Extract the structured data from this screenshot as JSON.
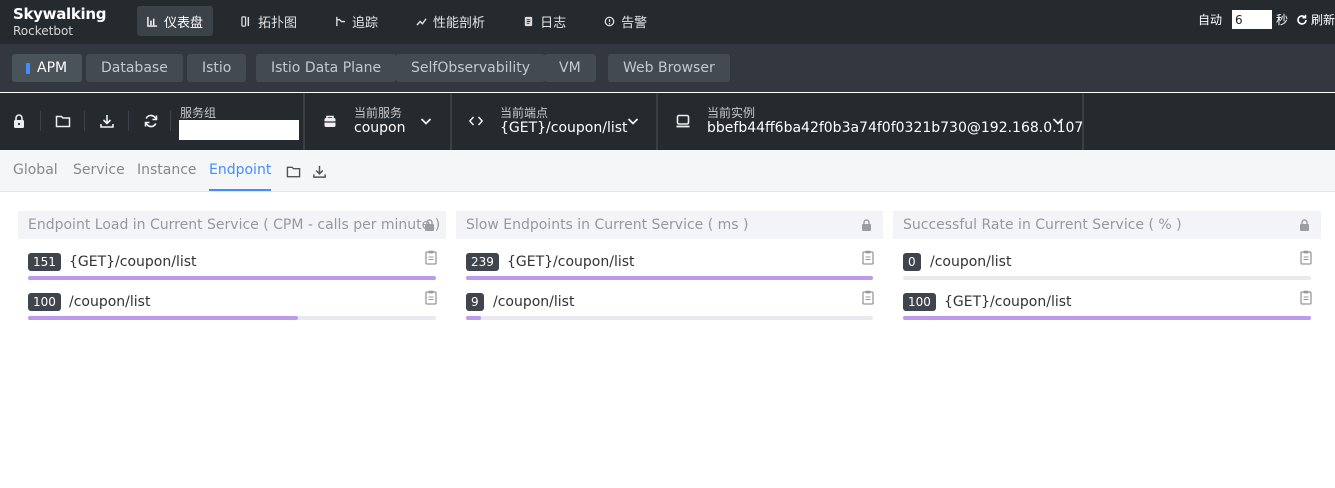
{
  "app": {
    "brand": "Skywalking",
    "subtitle": "Rocketbot"
  },
  "nav": [
    {
      "label": "仪表盘",
      "icon": "chart-icon",
      "active": true
    },
    {
      "label": "拓扑图",
      "icon": "topology-icon"
    },
    {
      "label": "追踪",
      "icon": "trace-icon"
    },
    {
      "label": "性能剖析",
      "icon": "profile-icon"
    },
    {
      "label": "日志",
      "icon": "log-icon"
    },
    {
      "label": "告警",
      "icon": "alarm-icon"
    }
  ],
  "auto_refresh": {
    "label": "自动",
    "interval": "6",
    "unit": "秒",
    "refresh_label": "刷新"
  },
  "templates": [
    "APM",
    "Database",
    "Istio",
    "Istio Data Plane",
    "SelfObservability",
    "VM",
    "Web Browser"
  ],
  "selectors": {
    "group": {
      "label": "服务组",
      "value": ""
    },
    "service": {
      "label": "当前服务",
      "value": "coupon"
    },
    "endpoint": {
      "label": "当前端点",
      "value": "{GET}/coupon/list"
    },
    "instance": {
      "label": "当前实例",
      "value": "bbefb44ff6ba42f0b3a74f0f0321b730@192.168.0.107"
    }
  },
  "dashboard_tabs": [
    "Global",
    "Service",
    "Instance",
    "Endpoint"
  ],
  "active_dashboard_tab": "Endpoint",
  "panels": [
    {
      "title": "Endpoint Load in Current Service ( CPM - calls per minute )",
      "rows": [
        {
          "value": "151",
          "label": "{GET}/coupon/list",
          "fraction": 1.0
        },
        {
          "value": "100",
          "label": "/coupon/list",
          "fraction": 0.662
        }
      ]
    },
    {
      "title": "Slow Endpoints in Current Service ( ms )",
      "rows": [
        {
          "value": "239",
          "label": "{GET}/coupon/list",
          "fraction": 1.0
        },
        {
          "value": "9",
          "label": "/coupon/list",
          "fraction": 0.038
        }
      ]
    },
    {
      "title": "Successful Rate in Current Service ( % )",
      "rows": [
        {
          "value": "0",
          "label": "/coupon/list",
          "fraction": 0.0
        },
        {
          "value": "100",
          "label": "{GET}/coupon/list",
          "fraction": 1.0
        }
      ]
    }
  ],
  "colors": {
    "accent": "#448dfe",
    "bar": "#bd9aea",
    "topbar": "#252a2f"
  }
}
